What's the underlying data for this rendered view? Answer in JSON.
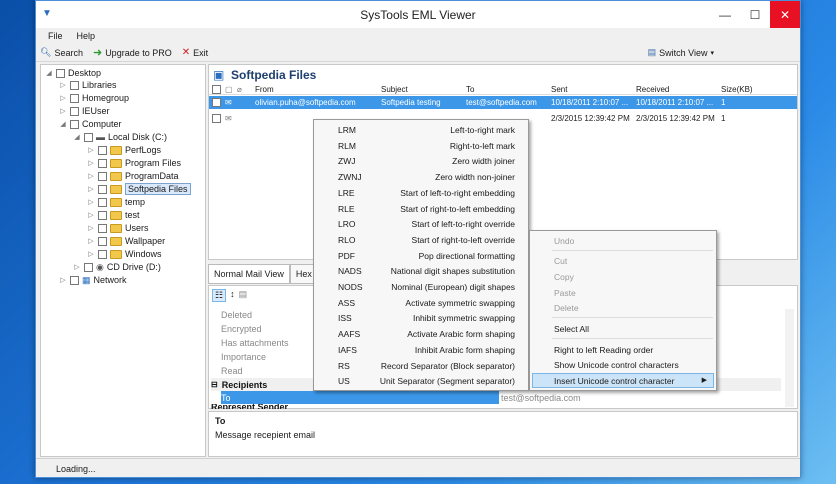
{
  "window": {
    "title": "SysTools EML Viewer"
  },
  "menu": [
    "File",
    "Help"
  ],
  "toolbar": {
    "search": "Search",
    "upgrade": "Upgrade to PRO",
    "exit": "Exit",
    "switch_view": "Switch View"
  },
  "tree": {
    "items": [
      "Desktop",
      "Libraries",
      "Homegroup",
      "IEUser",
      "Computer",
      "Local Disk (C:)",
      "PerfLogs",
      "Program Files",
      "ProgramData",
      "Softpedia Files",
      "temp",
      "test",
      "Users",
      "Wallpaper",
      "Windows",
      "CD Drive (D:)",
      "Network"
    ]
  },
  "panel": {
    "title": "Softpedia Files"
  },
  "columns": [
    "From",
    "Subject",
    "To",
    "Sent",
    "Received",
    "Size(KB)"
  ],
  "rows": [
    {
      "from": "olivian.puha@softpedia.com",
      "subject": "Softpedia testing",
      "to": "test@softpedia.com",
      "sent": "10/18/2011 2:10:07 ...",
      "received": "10/18/2011 2:10:07 ...",
      "size": "1"
    },
    {
      "from": "",
      "subject": "",
      "to": "",
      "sent": "2/3/2015 12:39:42 PM",
      "received": "2/3/2015 12:39:42 PM",
      "size": "1"
    }
  ],
  "tabs": [
    "Normal Mail View",
    "Hex Vi"
  ],
  "props": {
    "items": [
      "Deleted",
      "Encrypted",
      "Has attachments",
      "Importance",
      "Read"
    ],
    "section": "Recipients",
    "to_label": "To",
    "to_value": "test@softpedia.com",
    "next_section": "Represent Sender"
  },
  "desc": {
    "title": "To",
    "text": "Message recepient email"
  },
  "status": "Loading...",
  "unicode_menu": [
    [
      "LRM",
      "Left-to-right mark"
    ],
    [
      "RLM",
      "Right-to-left mark"
    ],
    [
      "ZWJ",
      "Zero width joiner"
    ],
    [
      "ZWNJ",
      "Zero width non-joiner"
    ],
    [
      "LRE",
      "Start of left-to-right embedding"
    ],
    [
      "RLE",
      "Start of right-to-left embedding"
    ],
    [
      "LRO",
      "Start of left-to-right override"
    ],
    [
      "RLO",
      "Start of right-to-left override"
    ],
    [
      "PDF",
      "Pop directional formatting"
    ],
    [
      "NADS",
      "National digit shapes substitution"
    ],
    [
      "NODS",
      "Nominal (European) digit shapes"
    ],
    [
      "ASS",
      "Activate symmetric swapping"
    ],
    [
      "ISS",
      "Inhibit symmetric swapping"
    ],
    [
      "AAFS",
      "Activate Arabic form shaping"
    ],
    [
      "IAFS",
      "Inhibit Arabic form shaping"
    ],
    [
      "RS",
      "Record Separator (Block separator)"
    ],
    [
      "US",
      "Unit Separator (Segment separator)"
    ]
  ],
  "edit_menu": {
    "undo": "Undo",
    "cut": "Cut",
    "copy": "Copy",
    "paste": "Paste",
    "delete": "Delete",
    "select_all": "Select All",
    "rtl": "Right to left Reading order",
    "show_ucc": "Show Unicode control characters",
    "insert_ucc": "Insert Unicode control character"
  }
}
